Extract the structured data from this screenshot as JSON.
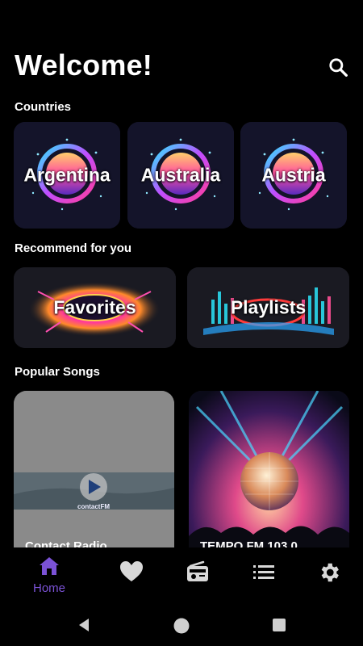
{
  "header": {
    "title": "Welcome!"
  },
  "sections": {
    "countries": "Countries",
    "recommend": "Recommend for you",
    "popular": "Popular Songs"
  },
  "countries": [
    {
      "label": "Argentina"
    },
    {
      "label": "Australia"
    },
    {
      "label": "Austria"
    }
  ],
  "recommend": [
    {
      "label": "Favorites"
    },
    {
      "label": "Playlists"
    }
  ],
  "songs": [
    {
      "title": "Contact Radio",
      "logo_text": "contactFM"
    },
    {
      "title": "TEMPO FM 103.0"
    }
  ],
  "bottom_nav": {
    "items": [
      {
        "label": "Home",
        "icon": "home-icon",
        "active": true
      },
      {
        "label": "",
        "icon": "heart-icon"
      },
      {
        "label": "",
        "icon": "radio-icon"
      },
      {
        "label": "",
        "icon": "list-icon"
      },
      {
        "label": "",
        "icon": "gear-icon"
      }
    ]
  },
  "colors": {
    "accent": "#7b52d6",
    "background": "#000000",
    "card": "#161625"
  }
}
